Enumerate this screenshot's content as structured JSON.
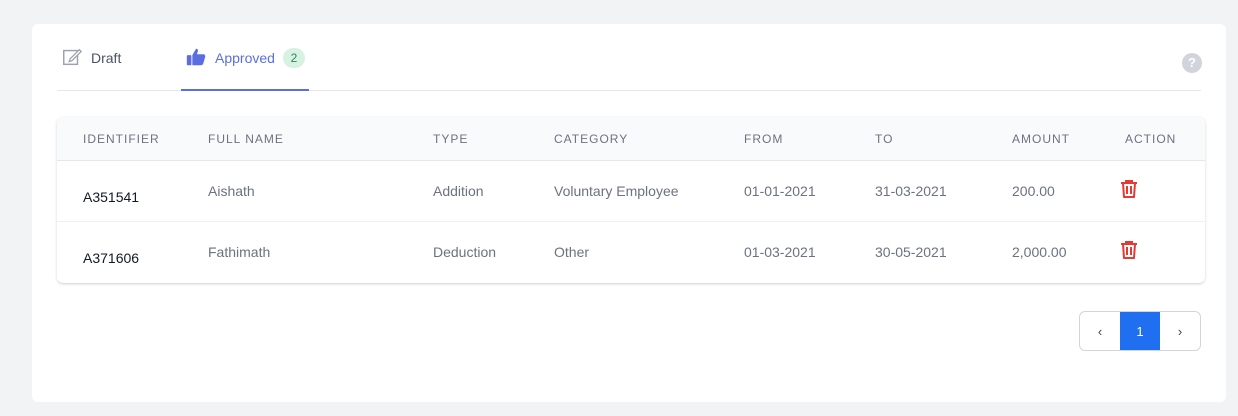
{
  "tabs": {
    "draft": {
      "label": "Draft",
      "icon": "edit-icon"
    },
    "approved": {
      "label": "Approved",
      "count": "2",
      "icon": "thumbs-up-icon"
    }
  },
  "help": {
    "label": "?",
    "icon": "help-icon"
  },
  "table": {
    "headers": [
      "IDENTIFIER",
      "FULL NAME",
      "TYPE",
      "CATEGORY",
      "FROM",
      "TO",
      "AMOUNT",
      "ACTION"
    ],
    "rows": [
      {
        "identifier": "A351541",
        "full_name": "Aishath",
        "type": "Addition",
        "category": "Voluntary Employee",
        "from": "01-01-2021",
        "to": "31-03-2021",
        "amount": "200.00",
        "action_icon": "trash-icon"
      },
      {
        "identifier": "A371606",
        "full_name": "Fathimath",
        "type": "Deduction",
        "category": "Other",
        "from": "01-03-2021",
        "to": "30-05-2021",
        "amount": "2,000.00",
        "action_icon": "trash-icon"
      }
    ]
  },
  "pagination": {
    "prev": "‹",
    "current": "1",
    "next": "›"
  },
  "colors": {
    "accent": "#5b6ee1",
    "badge_bg": "#d7f2e3",
    "delete": "#e53935",
    "page_active": "#1f6ff0"
  }
}
